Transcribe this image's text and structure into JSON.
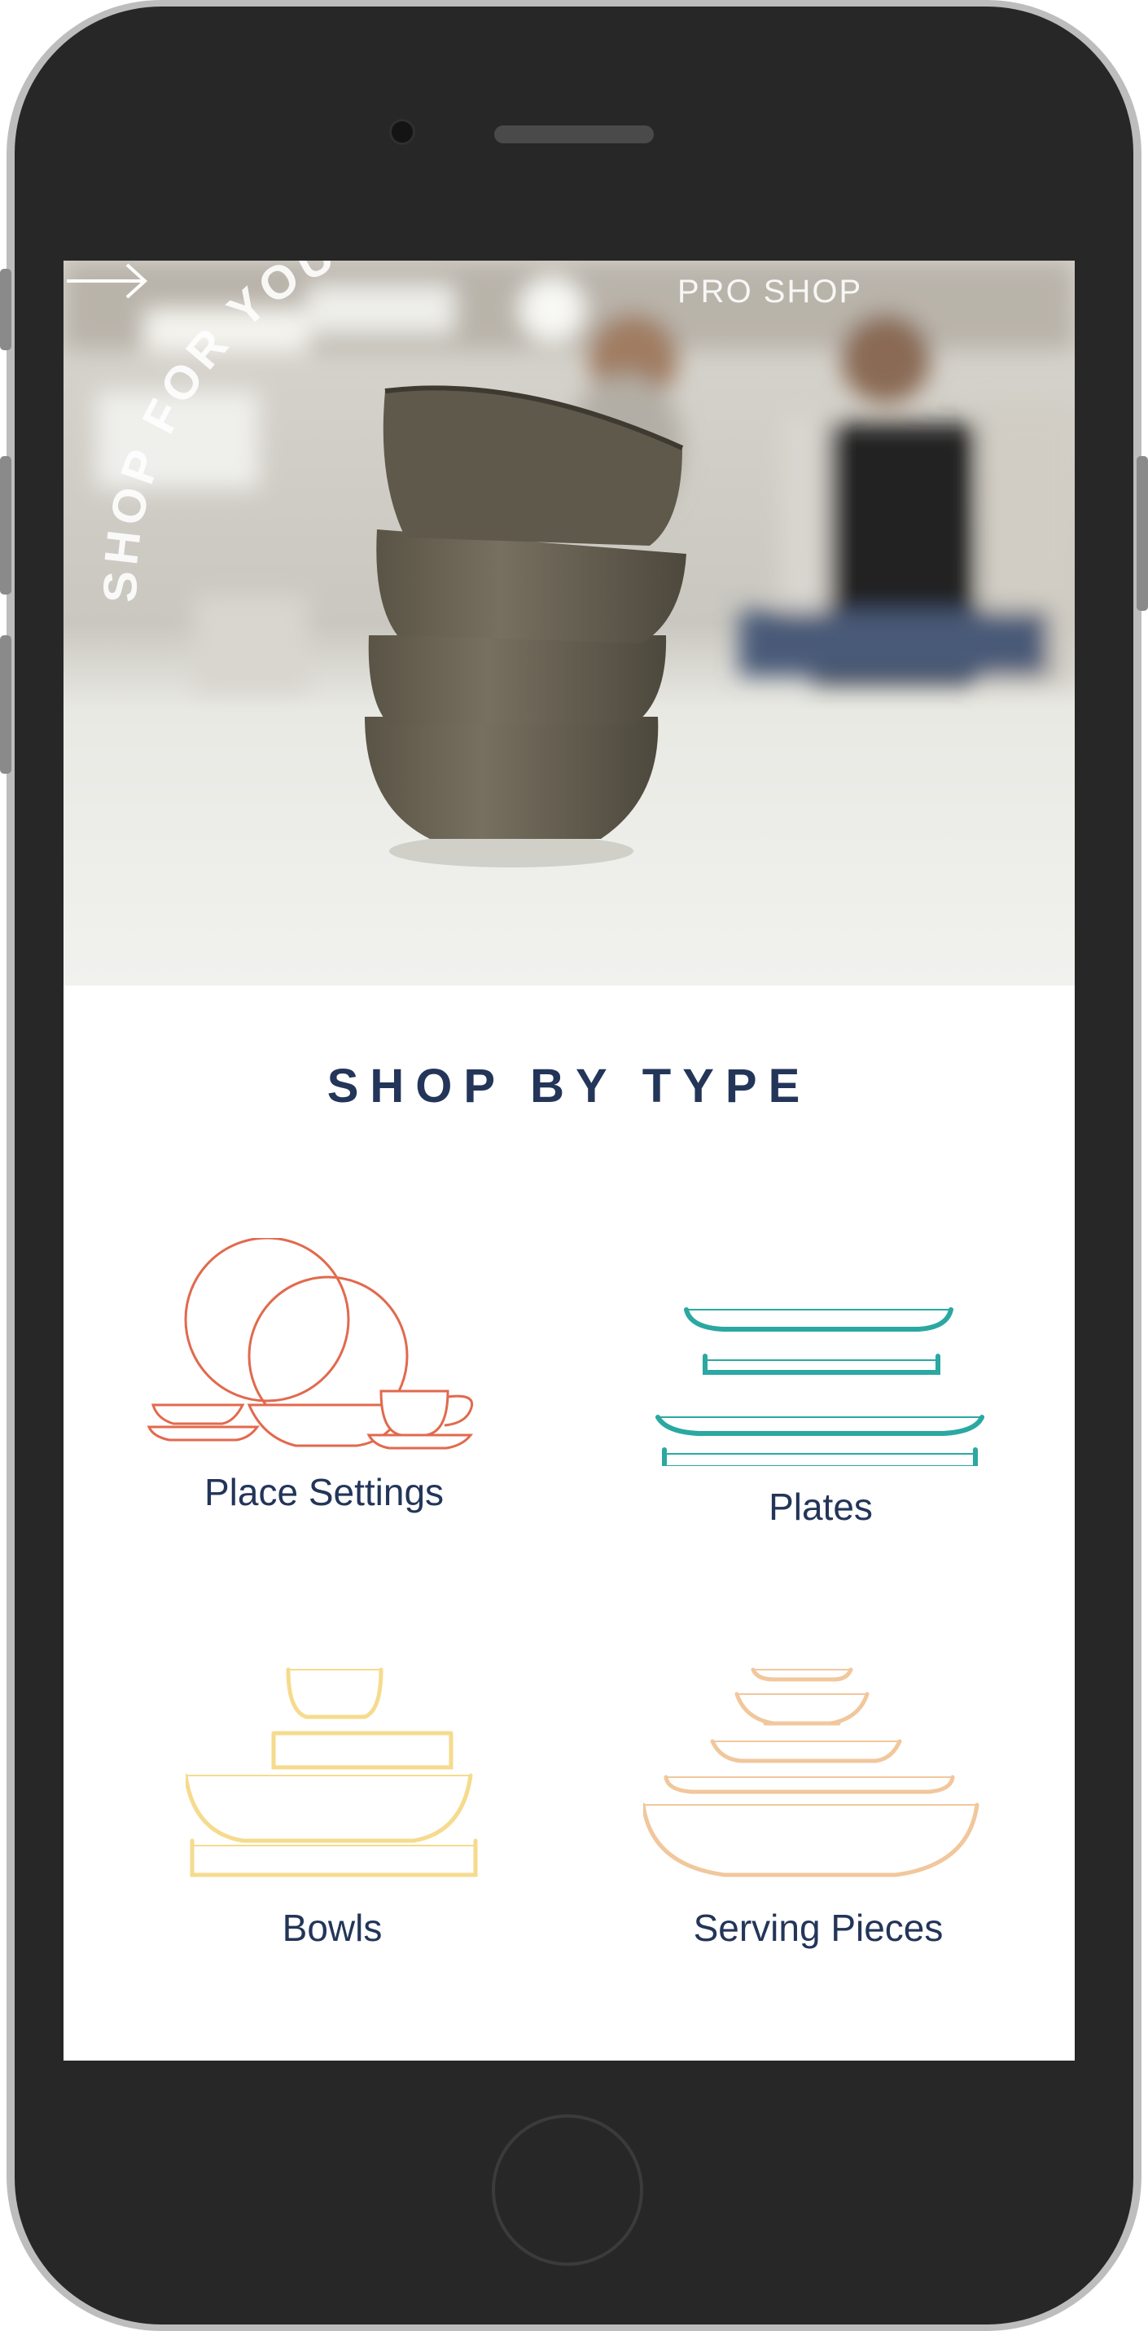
{
  "hero": {
    "curved_text": "SHOP FOR YOUR",
    "pro_shop_label": "PRO SHOP",
    "arrow_icon": "arrow-right-icon"
  },
  "section": {
    "title": "SHOP BY TYPE"
  },
  "categories": [
    {
      "label": "Place Settings",
      "icon": "place-settings-icon",
      "color": "#E2694D"
    },
    {
      "label": "Plates",
      "icon": "plates-icon",
      "color": "#2AA8A1"
    },
    {
      "label": "Bowls",
      "icon": "bowls-icon",
      "color": "#F6DB8E"
    },
    {
      "label": "Serving Pieces",
      "icon": "serving-pieces-icon",
      "color": "#F1C79C"
    }
  ],
  "colors": {
    "title": "#233559",
    "phone_body": "#272727"
  }
}
